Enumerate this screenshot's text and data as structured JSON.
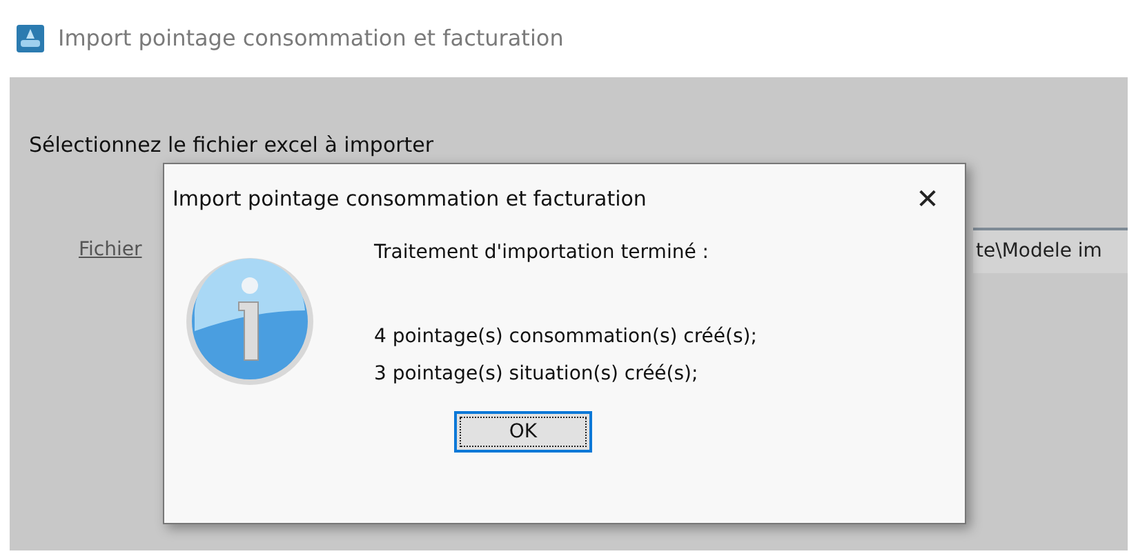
{
  "window": {
    "title": "Import pointage consommation et facturation"
  },
  "form": {
    "prompt": "Sélectionnez le fichier excel à importer",
    "file_link": "Fichier",
    "file_value": "te\\Modele im"
  },
  "dialog": {
    "title": "Import pointage consommation et facturation",
    "close": "✕",
    "lines": [
      "Traitement d'importation terminé :",
      "4 pointage(s) consommation(s) créé(s);",
      "3 pointage(s) situation(s) créé(s);"
    ],
    "button": "OK"
  }
}
